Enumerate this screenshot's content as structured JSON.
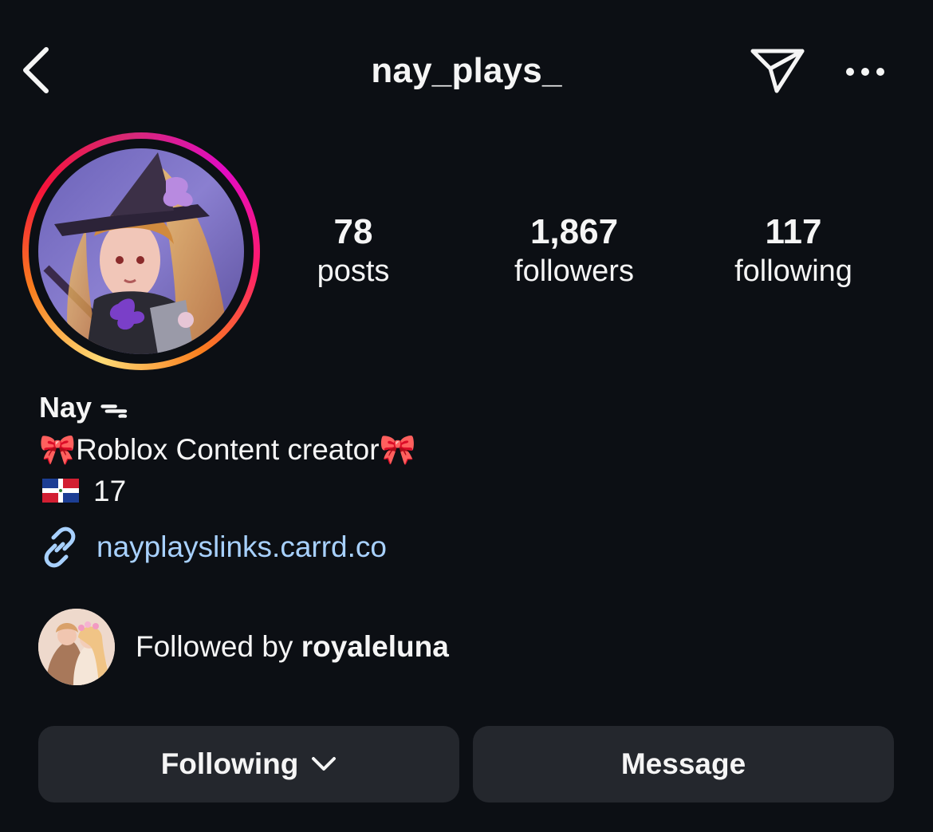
{
  "header": {
    "username": "nay_plays_"
  },
  "profile": {
    "stats": [
      {
        "value": "78",
        "label": "posts"
      },
      {
        "value": "1,867",
        "label": "followers"
      },
      {
        "value": "117",
        "label": "following"
      }
    ],
    "display_name": "Nay ᯓ",
    "bio_line_1": "🎀Roblox Content creator🎀",
    "bio_line_2": "17",
    "link": "nayplayslinks.carrd.co",
    "followed_by_prefix": "Followed by ",
    "followed_by_user": "royaleluna"
  },
  "actions": {
    "following_label": "Following",
    "message_label": "Message"
  },
  "icons": {
    "back": "chevron-left-icon",
    "send": "paper-plane-icon",
    "more": "ellipsis-icon",
    "link": "link-icon",
    "dropdown": "chevron-down-icon",
    "flag": "dominican-republic-flag-icon"
  },
  "colors": {
    "background": "#0c0f14",
    "button_bg": "#24272d",
    "link": "#a8d1ff",
    "text": "#f5f5f5"
  }
}
